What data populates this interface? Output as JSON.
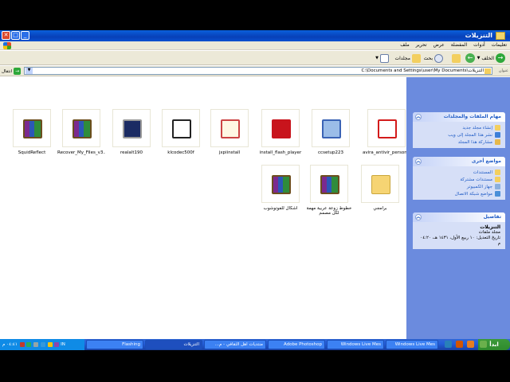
{
  "window": {
    "title": "التنزيلات",
    "menu": [
      "ملف",
      "تحرير",
      "عرض",
      "المفضلة",
      "أدوات",
      "تعليمات"
    ]
  },
  "toolbar": {
    "back_label": "الخلف",
    "search_label": "بحث",
    "folders_label": "مجلدات"
  },
  "address": {
    "label": "عنوان",
    "path": "C:\\Documents and Settings\\user\\My Documents\\التنزيلات",
    "go_label": "انتقال"
  },
  "files": [
    {
      "name": "avira_antivir_personal_en",
      "icon": "avira-icon"
    },
    {
      "name": "ccsetup223",
      "icon": "ccleaner-icon"
    },
    {
      "name": "install_flash_player",
      "icon": "flash-icon"
    },
    {
      "name": "jxpiinstall",
      "icon": "java-icon"
    },
    {
      "name": "klcodec500f",
      "icon": "klite-icon"
    },
    {
      "name": "realalt190",
      "icon": "real-icon"
    },
    {
      "name": "Recover_My_Files_v3....",
      "icon": "winrar-icon"
    },
    {
      "name": "SquidReflect",
      "icon": "winrar-icon"
    },
    {
      "name": "برامجي",
      "icon": "folder-icon"
    },
    {
      "name": "خطوط زوعة عربية مهمة لكل مصمم",
      "icon": "winrar-icon"
    },
    {
      "name": "اشكال للفوتوشوب",
      "icon": "winrar-icon"
    }
  ],
  "side": {
    "tasks_title": "مهام الملفات والمجلدات",
    "tasks": [
      "إنشاء مجلد جديد",
      "نشر هذا المجلد إلى ويب",
      "مشاركة هذا المجلد"
    ],
    "places_title": "مواضع أخرى",
    "places": [
      "المستندات",
      "مستندات مشتركة",
      "جهاز الكمبيوتر",
      "مواضع شبكة الاتصال"
    ],
    "details_title": "تفاصيل",
    "details_name": "التنزيلات",
    "details_type": "مجلد ملفات",
    "details_modified": "تاريخ التعديل: ١٠ ربيع الأول، ١٤٣١ هـ، ٠٤:٢٠ م"
  },
  "taskbar": {
    "start_label": "ابدأ",
    "tasks": [
      "التنزيلات",
      "منتديات اهل الثقافي - م...",
      "Adobe Photoshop",
      "Windows Live Mes",
      "Windows Live Mes"
    ],
    "tray_task": "Flashing",
    "clock": "٠٤:٤١ م",
    "lang": "IN"
  }
}
